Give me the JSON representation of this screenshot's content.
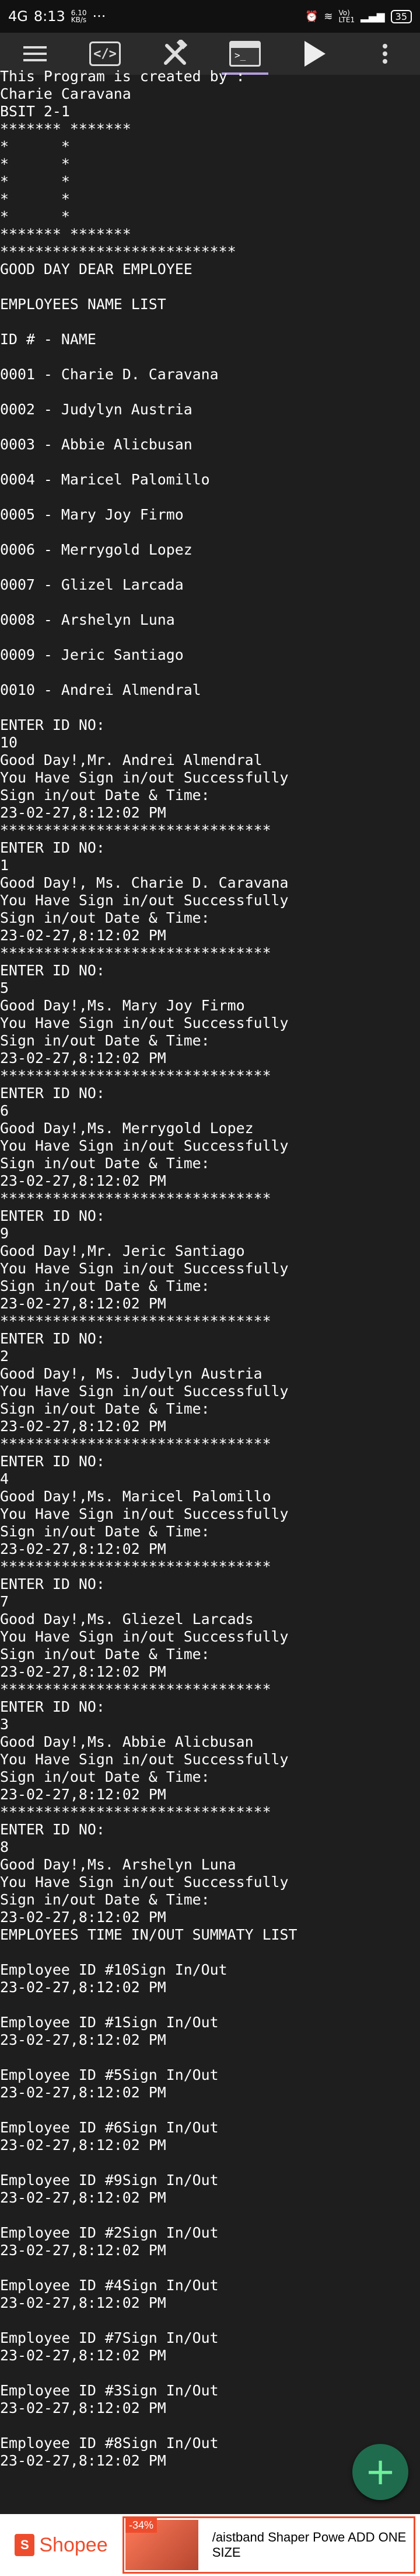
{
  "status_bar": {
    "signal_left": "4G",
    "signal_left_small": "4G",
    "time": "8:13",
    "speed": "6.10",
    "speed_unit": "KB/s",
    "more": "···",
    "network_right": "Vo)",
    "network_right2": "LTE1",
    "battery": "35"
  },
  "toolbar": {
    "items": [
      "menu",
      "code",
      "build",
      "terminal",
      "run",
      "more"
    ]
  },
  "output_lines": [
    "This Program is created by :",
    "Charie Caravana",
    "BSIT 2-1",
    "******* *******",
    "*      *",
    "*      *",
    "*      *",
    "*      *",
    "*      *",
    "******* *******",
    "***************************",
    "GOOD DAY DEAR EMPLOYEE",
    "",
    "EMPLOYEES NAME LIST",
    "",
    "ID # - NAME",
    "",
    "0001 - Charie D. Caravana",
    "",
    "0002 - Judylyn Austria",
    "",
    "0003 - Abbie Alicbusan",
    "",
    "0004 - Maricel Palomillo",
    "",
    "0005 - Mary Joy Firmo",
    "",
    "0006 - Merrygold Lopez",
    "",
    "0007 - Glizel Larcada",
    "",
    "0008 - Arshelyn Luna",
    "",
    "0009 - Jeric Santiago",
    "",
    "0010 - Andrei Almendral",
    "",
    "ENTER ID NO:",
    "10",
    "Good Day!,Mr. Andrei Almendral",
    "You Have Sign in/out Successfully",
    "Sign in/out Date & Time:",
    "23-02-27,8:12:02 PM",
    "*******************************",
    "ENTER ID NO:",
    "1",
    "Good Day!, Ms. Charie D. Caravana",
    "You Have Sign in/out Successfully",
    "Sign in/out Date & Time:",
    "23-02-27,8:12:02 PM",
    "*******************************",
    "ENTER ID NO:",
    "5",
    "Good Day!,Ms. Mary Joy Firmo",
    "You Have Sign in/out Successfully",
    "Sign in/out Date & Time:",
    "23-02-27,8:12:02 PM",
    "*******************************",
    "ENTER ID NO:",
    "6",
    "Good Day!,Ms. Merrygold Lopez",
    "You Have Sign in/out Successfully",
    "Sign in/out Date & Time:",
    "23-02-27,8:12:02 PM",
    "*******************************",
    "ENTER ID NO:",
    "9",
    "Good Day!,Mr. Jeric Santiago",
    "You Have Sign in/out Successfully",
    "Sign in/out Date & Time:",
    "23-02-27,8:12:02 PM",
    "*******************************",
    "ENTER ID NO:",
    "2",
    "Good Day!, Ms. Judylyn Austria",
    "You Have Sign in/out Successfully",
    "Sign in/out Date & Time:",
    "23-02-27,8:12:02 PM",
    "*******************************",
    "ENTER ID NO:",
    "4",
    "Good Day!,Ms. Maricel Palomillo",
    "You Have Sign in/out Successfully",
    "Sign in/out Date & Time:",
    "23-02-27,8:12:02 PM",
    "*******************************",
    "ENTER ID NO:",
    "7",
    "Good Day!,Ms. Gliezel Larcads",
    "You Have Sign in/out Successfully",
    "Sign in/out Date & Time:",
    "23-02-27,8:12:02 PM",
    "*******************************",
    "ENTER ID NO:",
    "3",
    "Good Day!,Ms. Abbie Alicbusan",
    "You Have Sign in/out Successfully",
    "Sign in/out Date & Time:",
    "23-02-27,8:12:02 PM",
    "*******************************",
    "ENTER ID NO:",
    "8",
    "Good Day!,Ms. Arshelyn Luna",
    "You Have Sign in/out Successfully",
    "Sign in/out Date & Time:",
    "23-02-27,8:12:02 PM",
    "EMPLOYEES TIME IN/OUT SUMMATY LIST",
    "",
    "Employee ID #10Sign In/Out",
    "23-02-27,8:12:02 PM",
    "",
    "Employee ID #1Sign In/Out",
    "23-02-27,8:12:02 PM",
    "",
    "Employee ID #5Sign In/Out",
    "23-02-27,8:12:02 PM",
    "",
    "Employee ID #6Sign In/Out",
    "23-02-27,8:12:02 PM",
    "",
    "Employee ID #9Sign In/Out",
    "23-02-27,8:12:02 PM",
    "",
    "Employee ID #2Sign In/Out",
    "23-02-27,8:12:02 PM",
    "",
    "Employee ID #4Sign In/Out",
    "23-02-27,8:12:02 PM",
    "",
    "Employee ID #7Sign In/Out",
    "23-02-27,8:12:02 PM",
    "",
    "Employee ID #3Sign In/Out",
    "23-02-27,8:12:02 PM",
    "",
    "Employee ID #8Sign In/Out",
    "23-02-27,8:12:02 PM"
  ],
  "fab": {
    "icon": "plus-icon",
    "color": "#6ef09a"
  },
  "ad": {
    "brand": "Shopee",
    "discount": "-34%",
    "title": "/aistband Shaper Powe ADD ONE SIZE",
    "accent": "#ee4d2d"
  }
}
